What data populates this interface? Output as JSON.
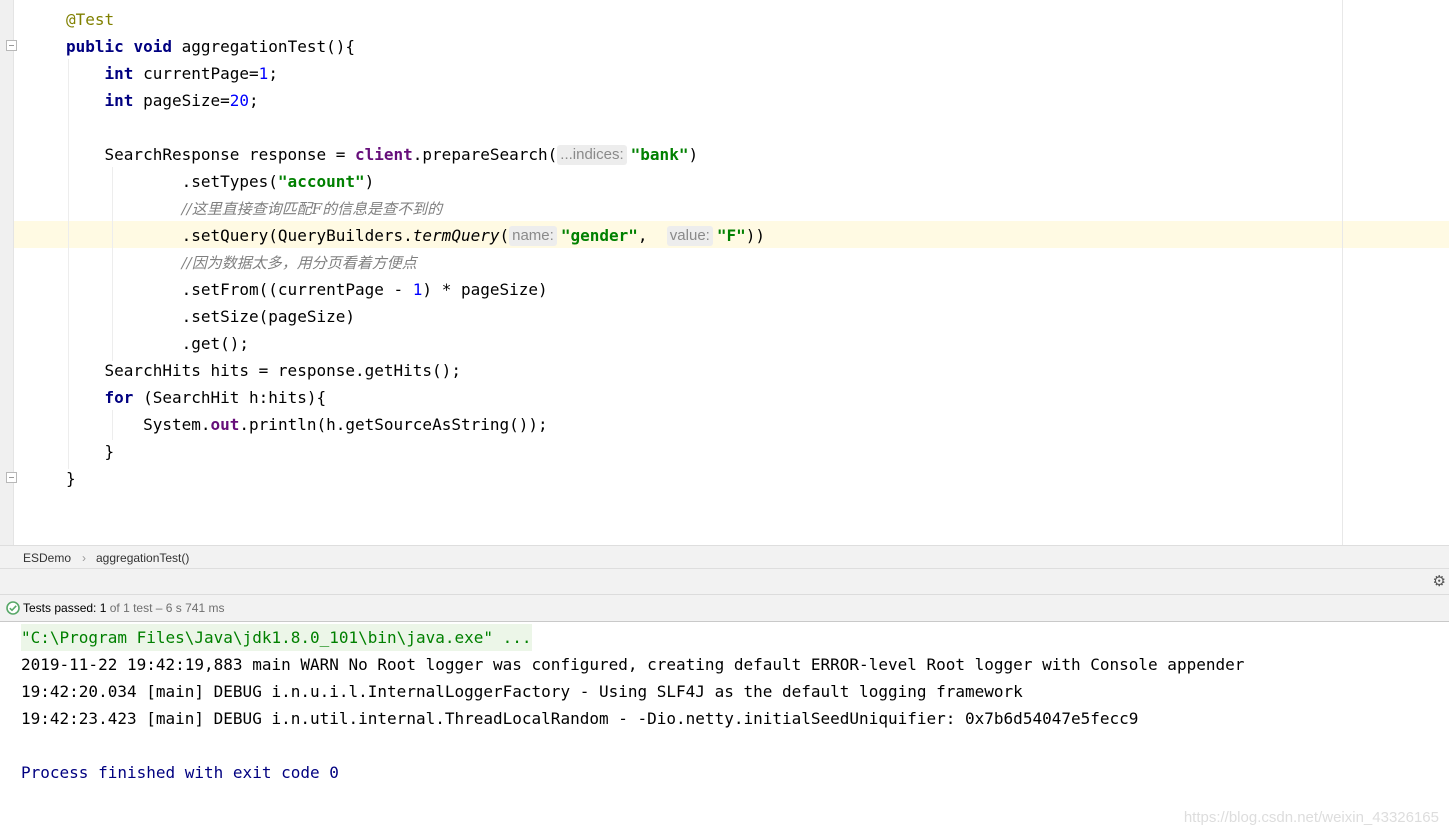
{
  "editor": {
    "lines": [
      {
        "segments": [
          {
            "t": "@Test",
            "c": "ann"
          }
        ]
      },
      {
        "segments": [
          {
            "t": "public",
            "c": "kw"
          },
          {
            "t": " "
          },
          {
            "t": "void",
            "c": "kw"
          },
          {
            "t": " aggregationTest(){"
          }
        ]
      },
      {
        "segments": [
          {
            "t": "    "
          },
          {
            "t": "int",
            "c": "kw"
          },
          {
            "t": " currentPage="
          },
          {
            "t": "1",
            "c": "num"
          },
          {
            "t": ";"
          }
        ]
      },
      {
        "segments": [
          {
            "t": "    "
          },
          {
            "t": "int",
            "c": "kw"
          },
          {
            "t": " pageSize="
          },
          {
            "t": "20",
            "c": "num"
          },
          {
            "t": ";"
          }
        ]
      },
      {
        "segments": []
      },
      {
        "segments": [
          {
            "t": "    SearchResponse response = "
          },
          {
            "t": "client",
            "c": "fld"
          },
          {
            "t": ".prepareSearch("
          },
          {
            "hint": "...indices:"
          },
          {
            "t": "\"bank\"",
            "c": "str"
          },
          {
            "t": ")"
          }
        ]
      },
      {
        "segments": [
          {
            "t": "            .setTypes("
          },
          {
            "t": "\"account\"",
            "c": "str"
          },
          {
            "t": ")"
          }
        ]
      },
      {
        "segments": [
          {
            "t": "            "
          },
          {
            "t": "//这里直接查询匹配F的信息是查不到的",
            "c": "cmt"
          }
        ]
      },
      {
        "segments": [
          {
            "t": "            .setQuery(QueryBuilders."
          },
          {
            "t": "termQuery",
            "c": "ital"
          },
          {
            "t": "("
          },
          {
            "hint": "name:"
          },
          {
            "t": "\"gender\"",
            "c": "str"
          },
          {
            "t": ",  "
          },
          {
            "hint": "value:"
          },
          {
            "t": "\"F\"",
            "c": "str"
          },
          {
            "t": "))"
          }
        ]
      },
      {
        "segments": [
          {
            "t": "            "
          },
          {
            "t": "//因为数据太多，用分页看着方便点",
            "c": "cmt"
          }
        ]
      },
      {
        "segments": [
          {
            "t": "            .setFrom((currentPage - "
          },
          {
            "t": "1",
            "c": "num"
          },
          {
            "t": ") * pageSize)"
          }
        ]
      },
      {
        "segments": [
          {
            "t": "            .setSize(pageSize)"
          }
        ]
      },
      {
        "segments": [
          {
            "t": "            .get();"
          }
        ]
      },
      {
        "segments": [
          {
            "t": "    SearchHits hits = response.getHits();"
          }
        ]
      },
      {
        "segments": [
          {
            "t": "    "
          },
          {
            "t": "for",
            "c": "kw"
          },
          {
            "t": " (SearchHit h:hits){"
          }
        ]
      },
      {
        "segments": [
          {
            "t": "        System."
          },
          {
            "t": "out",
            "c": "fld"
          },
          {
            "t": ".println(h.getSourceAsString());"
          }
        ]
      },
      {
        "segments": [
          {
            "t": "    }"
          }
        ]
      },
      {
        "segments": [
          {
            "t": "}"
          }
        ]
      }
    ]
  },
  "breadcrumb": {
    "items": [
      "ESDemo",
      "aggregationTest()"
    ],
    "separator": "›"
  },
  "run": {
    "settings_icon": "gear-icon",
    "status": {
      "icon": "check-circle-icon",
      "label": "Tests passed:",
      "passed": "1",
      "detail": "of 1 test – 6 s 741 ms"
    },
    "console": {
      "command": "\"C:\\Program Files\\Java\\jdk1.8.0_101\\bin\\java.exe\" ...",
      "log_lines": [
        "2019-11-22 19:42:19,883 main WARN No Root logger was configured, creating default ERROR-level Root logger with Console appender",
        "19:42:20.034 [main] DEBUG i.n.u.i.l.InternalLoggerFactory - Using SLF4J as the default logging framework",
        "19:42:23.423 [main] DEBUG i.n.util.internal.ThreadLocalRandom - -Dio.netty.initialSeedUniquifier: 0x7b6d54047e5fecc9"
      ],
      "exit_message": "Process finished with exit code 0"
    }
  },
  "watermark": "https://blog.csdn.net/weixin_43326165",
  "colors": {
    "keyword": "#000080",
    "string": "#008000",
    "number": "#0000ff",
    "annotation": "#808000",
    "field": "#660e7a",
    "comment": "#808080",
    "highlight_line": "#fffae3",
    "success": "#59a869"
  }
}
